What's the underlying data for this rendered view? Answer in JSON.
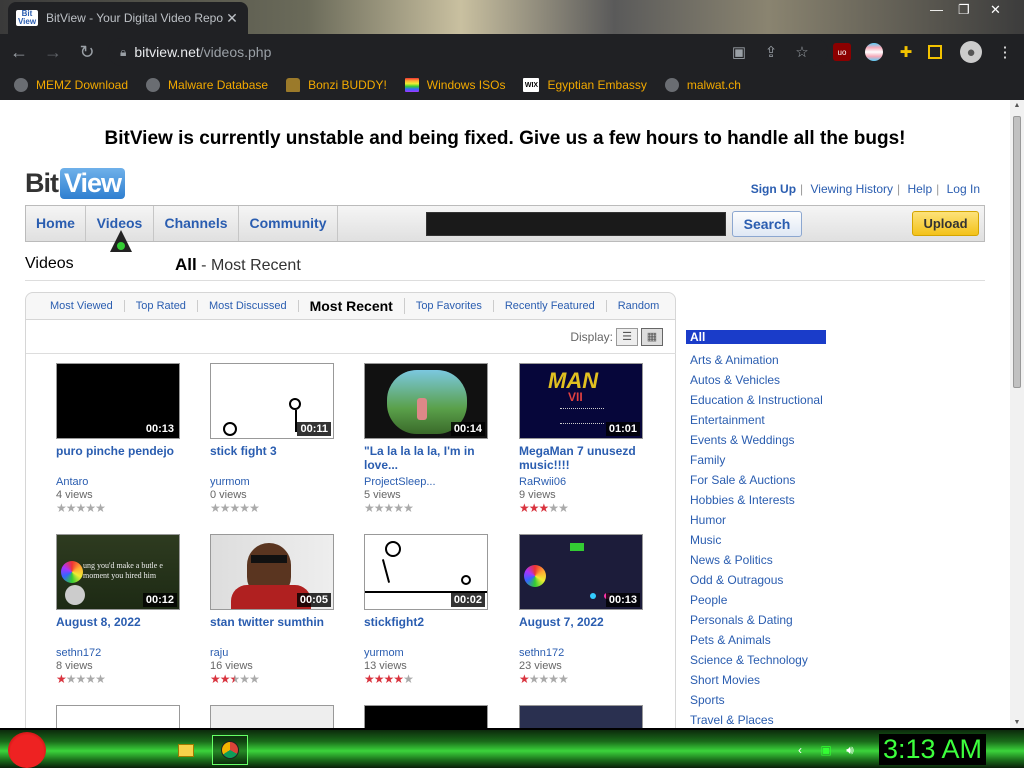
{
  "browser": {
    "tab_title": "BitView - Your Digital Video Repo",
    "tab_favicon_text": "Bit View",
    "url_domain": "bitview.net",
    "url_path": "/videos.php",
    "bookmarks": [
      {
        "label": "MEMZ Download",
        "icon": "globe-icon"
      },
      {
        "label": "Malware Database",
        "icon": "globe-icon"
      },
      {
        "label": "Bonzi BUDDY!",
        "icon": "bonzi-icon"
      },
      {
        "label": "Windows ISOs",
        "icon": "windows-icon"
      },
      {
        "label": "Egyptian Embassy",
        "icon": "wix-icon"
      },
      {
        "label": "malwat.ch",
        "icon": "globe-icon"
      }
    ],
    "wix_text": "WIX"
  },
  "site": {
    "banner": "BitView is currently unstable and being fixed. Give us a few hours to handle all the bugs!",
    "logo_bit": "Bit",
    "logo_view": "View",
    "toplinks": {
      "signup": "Sign Up",
      "history": "Viewing History",
      "help": "Help",
      "login": "Log In"
    },
    "nav": {
      "home": "Home",
      "videos": "Videos",
      "channels": "Channels",
      "community": "Community"
    },
    "search_button": "Search",
    "upload_button": "Upload",
    "page_title": "Videos",
    "section_all": "All",
    "section_rest": " - Most Recent",
    "subnav": [
      "Most Viewed",
      "Top Rated",
      "Most Discussed",
      "Most Recent",
      "Top Favorites",
      "Recently Featured",
      "Random"
    ],
    "display_label": "Display:"
  },
  "videos": [
    {
      "title": "puro pinche pendejo",
      "user": "Antaro",
      "views": "4 views",
      "duration": "00:13",
      "rating": 0
    },
    {
      "title": "stick fight 3",
      "user": "yurmom",
      "views": "0 views",
      "duration": "00:11",
      "rating": 0
    },
    {
      "title": "\"La la la la la, I'm in love...",
      "user": "ProjectSleep...",
      "views": "5 views",
      "duration": "00:14",
      "rating": 0
    },
    {
      "title": "MegaMan 7 unusezd music!!!!",
      "user": "RaRwii06",
      "views": "9 views",
      "duration": "01:01",
      "rating": 3
    },
    {
      "title": "August 8, 2022",
      "user": "sethn172",
      "views": "8 views",
      "duration": "00:12",
      "rating": 1
    },
    {
      "title": "stan twitter sumthin",
      "user": "raju",
      "views": "16 views",
      "duration": "00:05",
      "rating": 2.5
    },
    {
      "title": "stickfight2",
      "user": "yurmom",
      "views": "13 views",
      "duration": "00:02",
      "rating": 4
    },
    {
      "title": "August 7, 2022",
      "user": "sethn172",
      "views": "23 views",
      "duration": "00:13",
      "rating": 1
    }
  ],
  "thumb_text": {
    "megaman_title": "MAN",
    "megaman_number": "VII",
    "august8_caption": "ung you'd make a butle e moment you hired him"
  },
  "categories": [
    "All",
    "Arts & Animation",
    "Autos & Vehicles",
    "Education & Instructional",
    "Entertainment",
    "Events & Weddings",
    "Family",
    "For Sale & Auctions",
    "Hobbies & Interests",
    "Humor",
    "Music",
    "News & Politics",
    "Odd & Outragous",
    "People",
    "Personals & Dating",
    "Pets & Animals",
    "Science & Technology",
    "Short Movies",
    "Sports",
    "Travel & Places"
  ],
  "taskbar": {
    "clock": "3:13 AM"
  },
  "colors": {
    "link": "#2a5db0",
    "category_active": "#1a3cc9",
    "upload": "#f3c21a",
    "star_on": "#d9343f",
    "star_off": "#aaaaaa",
    "clock": "#3dff3d"
  }
}
